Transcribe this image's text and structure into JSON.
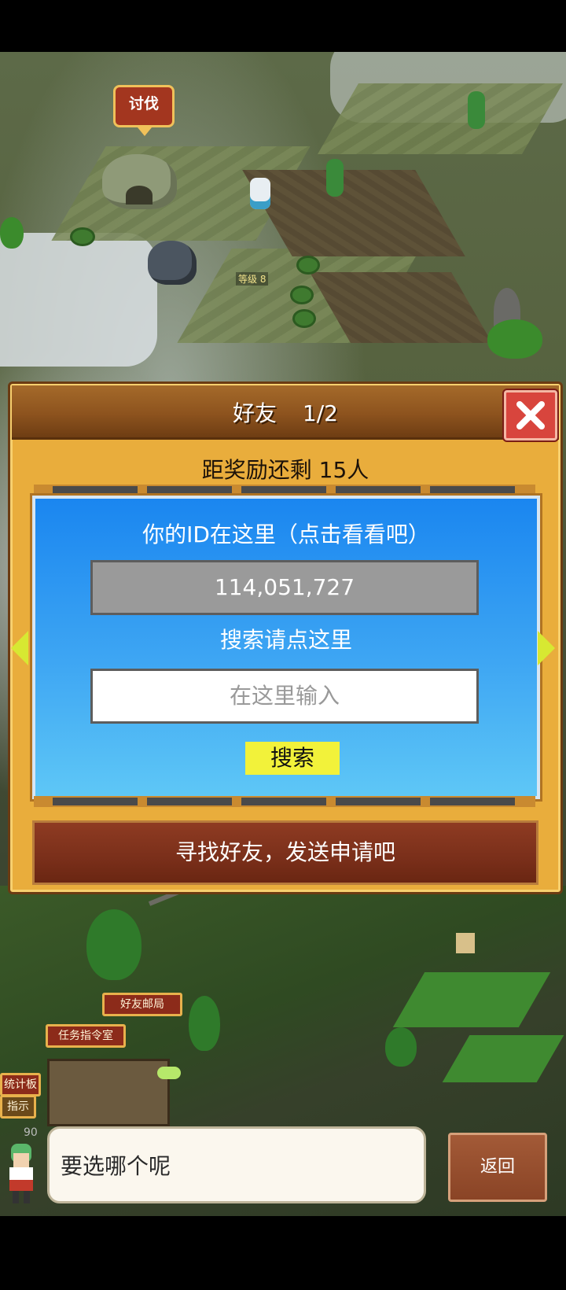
{
  "map": {
    "raid_badge": "讨伐",
    "character_level": "等级 8",
    "signs": {
      "friend_post": "好友邮局",
      "mission_room": "任务指令室",
      "stats_board": "统计板",
      "instruction": "指示"
    }
  },
  "dialog": {
    "title": "好友",
    "page": "1/2",
    "reward_text": "距奖励还剩 15人",
    "id_prompt": "你的ID在这里（点击看看吧）",
    "user_id": "114,051,727",
    "search_prompt": "搜索请点这里",
    "search_placeholder": "在这里输入",
    "search_button": "搜索",
    "find_friends_button": "寻找好友，发送申请吧"
  },
  "bottom": {
    "speech_text": "要选哪个呢",
    "back_button": "返回",
    "level_number": "90"
  },
  "colors": {
    "close_red": "#d8453d",
    "panel_blue": "#1a86f0",
    "search_yellow": "#f2f23a",
    "dialog_gold": "#e9ad3c",
    "arrow_yellow": "#d7e832"
  }
}
